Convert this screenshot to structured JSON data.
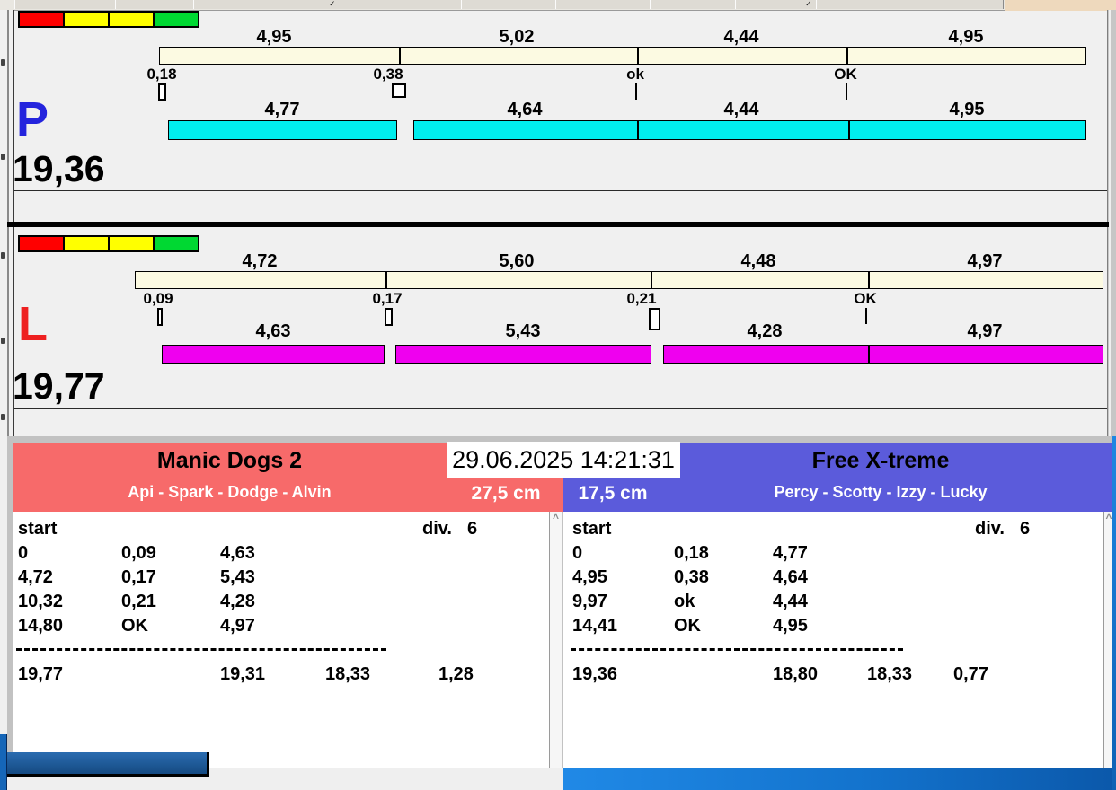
{
  "window": {
    "top_right_accent_color": "#eed9bd",
    "lights_colors": [
      "#ff0000",
      "#ffff00",
      "#ffff00",
      "#00d832"
    ]
  },
  "clock": "29.06.2025 14:21:31",
  "lanes": [
    {
      "letter": "P",
      "letter_color": "#2424dd",
      "total": "19,36",
      "track_color": "#fcfae2",
      "bar_color": "#00efef",
      "splits": [
        "4,95",
        "5,02",
        "4,44",
        "4,95"
      ],
      "crosses": [
        "0,18",
        "0,38",
        "ok",
        "OK"
      ],
      "times": [
        "4,77",
        "4,64",
        "4,44",
        "4,95"
      ]
    },
    {
      "letter": "L",
      "letter_color": "#ee2020",
      "total": "19,77",
      "track_color": "#fcfae2",
      "bar_color": "#ef00ef",
      "splits": [
        "4,72",
        "5,60",
        "4,48",
        "4,97"
      ],
      "crosses": [
        "0,09",
        "0,17",
        "0,21",
        "OK"
      ],
      "times": [
        "4,63",
        "5,43",
        "4,28",
        "4,97"
      ]
    }
  ],
  "teams": [
    {
      "name": "Manic Dogs 2",
      "dogs": "Api - Spark - Dodge - Alvin",
      "jump_height": "27,5 cm",
      "header_color": "#f76a6a",
      "table": {
        "start_label": "start",
        "div_label": "div.",
        "div_value": "6",
        "rows": [
          [
            "0",
            "0,09",
            "4,63"
          ],
          [
            "4,72",
            "0,17",
            "5,43"
          ],
          [
            "10,32",
            "0,21",
            "4,28"
          ],
          [
            "14,80",
            "OK",
            "4,97"
          ]
        ],
        "totals": [
          "19,77",
          "19,31",
          "18,33",
          "1,28"
        ]
      }
    },
    {
      "name": "Free X-treme",
      "dogs": "Percy - Scotty - Izzy - Lucky",
      "jump_height": "17,5 cm",
      "header_color": "#5b5bdb",
      "table": {
        "start_label": "start",
        "div_label": "div.",
        "div_value": "6",
        "rows": [
          [
            "0",
            "0,18",
            "4,77"
          ],
          [
            "4,95",
            "0,38",
            "4,64"
          ],
          [
            "9,97",
            "ok",
            "4,44"
          ],
          [
            "14,41",
            "OK",
            "4,95"
          ]
        ],
        "totals": [
          "19,36",
          "18,80",
          "18,33",
          "0,77"
        ]
      }
    }
  ]
}
